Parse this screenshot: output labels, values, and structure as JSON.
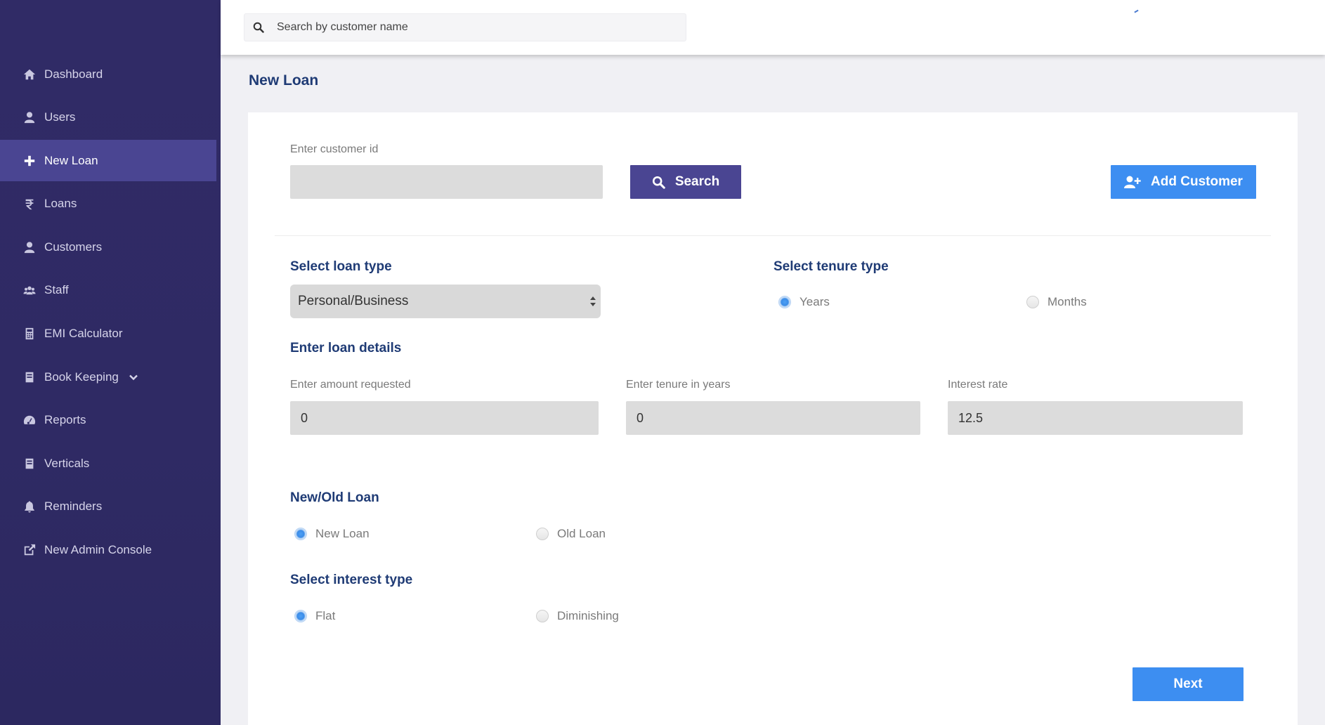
{
  "sidebar": {
    "items": [
      {
        "label": "Dashboard",
        "icon": "home-icon",
        "active": false
      },
      {
        "label": "Users",
        "icon": "user-icon",
        "active": false
      },
      {
        "label": "New Loan",
        "icon": "plus-icon",
        "active": true
      },
      {
        "label": "Loans",
        "icon": "rupee-icon",
        "active": false
      },
      {
        "label": "Customers",
        "icon": "user-icon",
        "active": false
      },
      {
        "label": "Staff",
        "icon": "group-icon",
        "active": false
      },
      {
        "label": "EMI Calculator",
        "icon": "calculator-icon",
        "active": false
      },
      {
        "label": "Book Keeping",
        "icon": "book-icon",
        "active": false
      },
      {
        "label": "Reports",
        "icon": "dashboard-gauge-icon",
        "active": false
      },
      {
        "label": "Verticals",
        "icon": "book-icon",
        "active": false
      },
      {
        "label": "Reminders",
        "icon": "bell-icon",
        "active": false
      },
      {
        "label": "New Admin Console",
        "icon": "external-link-icon",
        "active": false
      }
    ]
  },
  "topbar": {
    "search_placeholder": "Search by customer name"
  },
  "page": {
    "title": "New Loan"
  },
  "customer": {
    "id_label": "Enter customer id",
    "id_value": "",
    "search_button": "Search",
    "add_button": "Add Customer"
  },
  "loan_type": {
    "heading": "Select loan type",
    "selected": "Personal/Business"
  },
  "tenure_type": {
    "heading": "Select tenure type",
    "options": [
      {
        "label": "Years",
        "selected": true
      },
      {
        "label": "Months",
        "selected": false
      }
    ]
  },
  "loan_details": {
    "heading": "Enter loan details",
    "amount_label": "Enter amount requested",
    "amount_value": "0",
    "tenure_label": "Enter tenure in years",
    "tenure_value": "0",
    "rate_label": "Interest rate",
    "rate_value": "12.5"
  },
  "new_old": {
    "heading": "New/Old Loan",
    "options": [
      {
        "label": "New Loan",
        "selected": true
      },
      {
        "label": "Old Loan",
        "selected": false
      }
    ]
  },
  "interest_type": {
    "heading": "Select interest type",
    "options": [
      {
        "label": "Flat",
        "selected": true
      },
      {
        "label": "Diminishing",
        "selected": false
      }
    ]
  },
  "actions": {
    "next_button": "Next"
  },
  "colors": {
    "sidebar_bg": "#302b66",
    "sidebar_active": "#4a4592",
    "primary_blue": "#3d8ef1",
    "heading_navy": "#1f3b75"
  }
}
